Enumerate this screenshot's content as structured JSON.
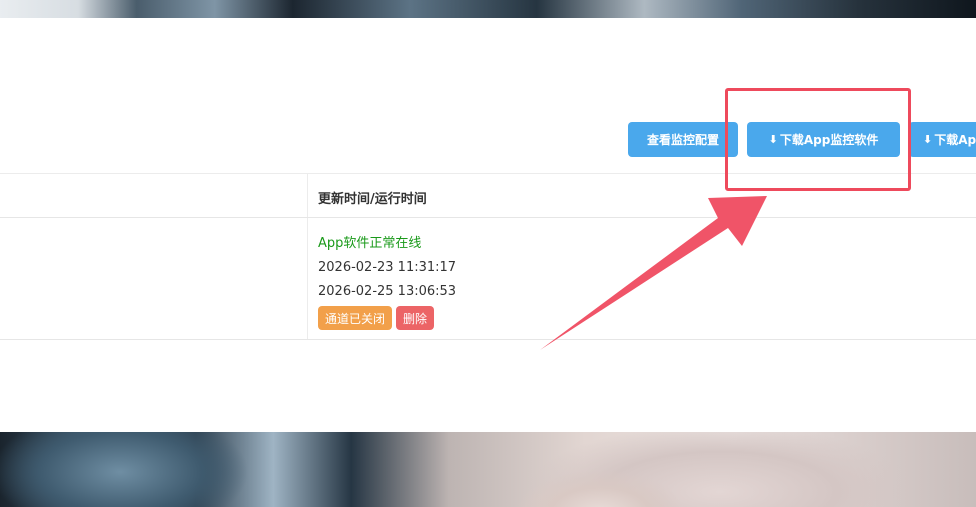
{
  "toolbar": {
    "view_config_label": "查看监控配置",
    "download_app_label": "下载App监控软件",
    "download_app_partial_label": "下载Ap",
    "download_icon": "download-icon"
  },
  "table": {
    "header": {
      "update_time_label": "更新时间/运行时间"
    },
    "row": {
      "status": "App软件正常在线",
      "update_time": "2026-02-23 11:31:17",
      "run_time": "2026-02-25 13:06:53",
      "channel_closed_tag": "通道已关闭",
      "delete_button": "删除"
    }
  },
  "annotation": {
    "highlight_color": "#ee4a5c",
    "arrow_color": "#f05468"
  },
  "colors": {
    "primary_button": "#4aa8ec",
    "status_online": "#1a9a1a",
    "tag_warning": "#f2a04a",
    "tag_danger": "#ec6466"
  }
}
